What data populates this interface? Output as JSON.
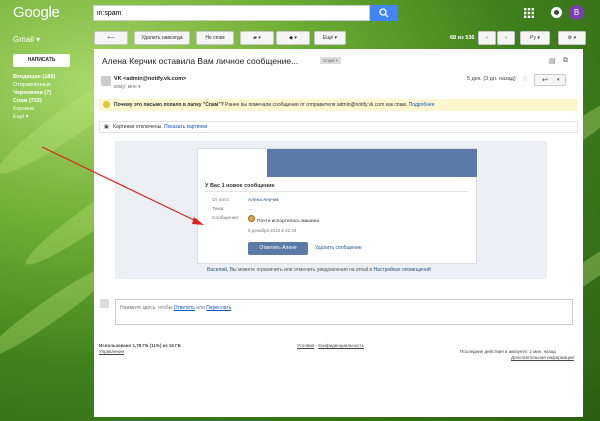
{
  "brand": "Google",
  "search": {
    "value": "in:spam"
  },
  "user": {
    "avatar_letter": "B"
  },
  "toolbar": {
    "gmail_label": "Gmail",
    "not_spam": "Удалить навсегда",
    "not_spam2": "Не спам",
    "more": "Ещё",
    "pager": "68 из 536",
    "lang": "Ру"
  },
  "sidebar": {
    "compose": "НАПИСАТЬ",
    "items": [
      "Входящие (185)",
      "Отправленные",
      "Черновики (7)",
      "Спам (722)",
      "Корзина",
      "Ещё"
    ]
  },
  "message": {
    "subject": "Алена Керчик оставила Вам личное сообщение...",
    "label": "Спам",
    "sender": "VK <admin@notify.vk.com>",
    "to": "кому: мне",
    "date": "5 дек. (3 дн. назад)",
    "warning_bold": "Почему это письмо попало в папку \"Спам\"?",
    "warning_text": "Ранее вы помечали сообщения от отправителя admin@notify.vk.com как спам.",
    "warning_link": "Подробнее",
    "images_off": "Картинки отключены.",
    "images_link": "Показать картинки"
  },
  "vk": {
    "header": "У Вас 1 новое сообщение",
    "from_label": "От кого:",
    "from_value": "Алена Керчик",
    "topic_label": "Тема:",
    "topic_value": "...",
    "msg_label": "Сообщение:",
    "msg_value": "Почти испортилась машина",
    "msg_date": "5 декабря 2016 в 22:44",
    "reply_button": "Ответить Алене",
    "delete_link": "Удалить сообщение",
    "footer_name": "Василий",
    "footer_text": ", Вы можете ограничить или отменить уведомления на email в",
    "footer_link": "Настройках оповещений"
  },
  "reply": {
    "prompt": "Нажмите здесь, чтобы",
    "reply_link": "Ответить",
    "or": "или",
    "forward_link": "Переслать"
  },
  "footer": {
    "usage": "Использовано 1,78 ГБ (11%) из 15 ГБ",
    "manage": "Управление",
    "terms": "Условия",
    "privacy": "Конфиденциальность",
    "last_activity": "Последние действия в аккаунте: 2 мин. назад",
    "details": "Дополнительная информация"
  },
  "colors": {
    "accent": "#4285f4",
    "vk_blue": "#5b7aa8",
    "warning_bg": "#fdf7cf"
  }
}
